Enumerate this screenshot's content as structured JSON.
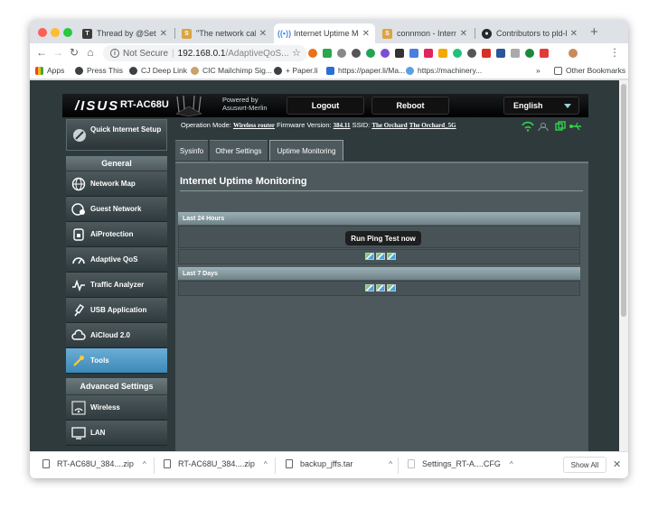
{
  "browser": {
    "tabs": [
      {
        "label": "Thread by @SethAbra",
        "favicon": "thread-reader-icon"
      },
      {
        "label": "\"The network cable is",
        "favicon": "superuser-icon"
      },
      {
        "label": "Internet Uptime Monit",
        "favicon": "network-icon"
      },
      {
        "label": "connmon - Internet co",
        "favicon": "superuser-icon"
      },
      {
        "label": "Contributors to pld-lin",
        "favicon": "github-icon"
      }
    ],
    "address": {
      "security": "Not Secure",
      "host": "192.168.0.1",
      "path": "/AdaptiveQoS..."
    },
    "bookmarks": [
      {
        "label": "Apps"
      },
      {
        "label": "Press This"
      },
      {
        "label": "CJ Deep Link"
      },
      {
        "label": "CIC Mailchimp Sig..."
      },
      {
        "label": "+ Paper.li"
      },
      {
        "label": "https://paper.li/Ma..."
      },
      {
        "label": "https://machinery..."
      },
      {
        "label": "Other Bookmarks"
      }
    ],
    "more_chevron": "»"
  },
  "router": {
    "brand": "/ISUS",
    "model": "RT-AC68U",
    "powered_line1": "Powered by",
    "powered_line2": "Asuswrt-Merlin",
    "logout": "Logout",
    "reboot": "Reboot",
    "language": "English",
    "opmode_label": "Operation Mode:",
    "opmode_value": "Wireless router",
    "firmware_label": "Firmware Version:",
    "firmware_value": "384.11",
    "ssid_label": "SSID:",
    "ssid_1": "The Orchard",
    "ssid_2": "The Orchard_5G",
    "quick_setup": "Quick Internet Setup",
    "general_header": "General",
    "general_items": [
      {
        "label": "Network Map"
      },
      {
        "label": "Guest Network"
      },
      {
        "label": "AiProtection"
      },
      {
        "label": "Adaptive QoS"
      },
      {
        "label": "Traffic Analyzer"
      },
      {
        "label": "USB Application"
      },
      {
        "label": "AiCloud 2.0"
      },
      {
        "label": "Tools"
      }
    ],
    "advanced_header": "Advanced Settings",
    "advanced_items": [
      {
        "label": "Wireless"
      },
      {
        "label": "LAN"
      }
    ],
    "subtabs": [
      {
        "label": "Sysinfo"
      },
      {
        "label": "Other Settings"
      },
      {
        "label": "Uptime Monitoring"
      }
    ],
    "panel_title": "Internet Uptime Monitoring",
    "section_24h": "Last 24 Hours",
    "ping_button": "Run Ping Test now",
    "section_7d": "Last 7 Days"
  },
  "downloads": {
    "items": [
      {
        "label": "RT-AC68U_384....zip"
      },
      {
        "label": "RT-AC68U_384....zip"
      },
      {
        "label": "backup_jffs.tar"
      },
      {
        "label": "Settings_RT-A....CFG"
      }
    ],
    "show_all": "Show All"
  },
  "colors": {
    "accent_blue": "#5aa0cf",
    "panel": "#4d595d",
    "background": "#2f3a3d"
  }
}
